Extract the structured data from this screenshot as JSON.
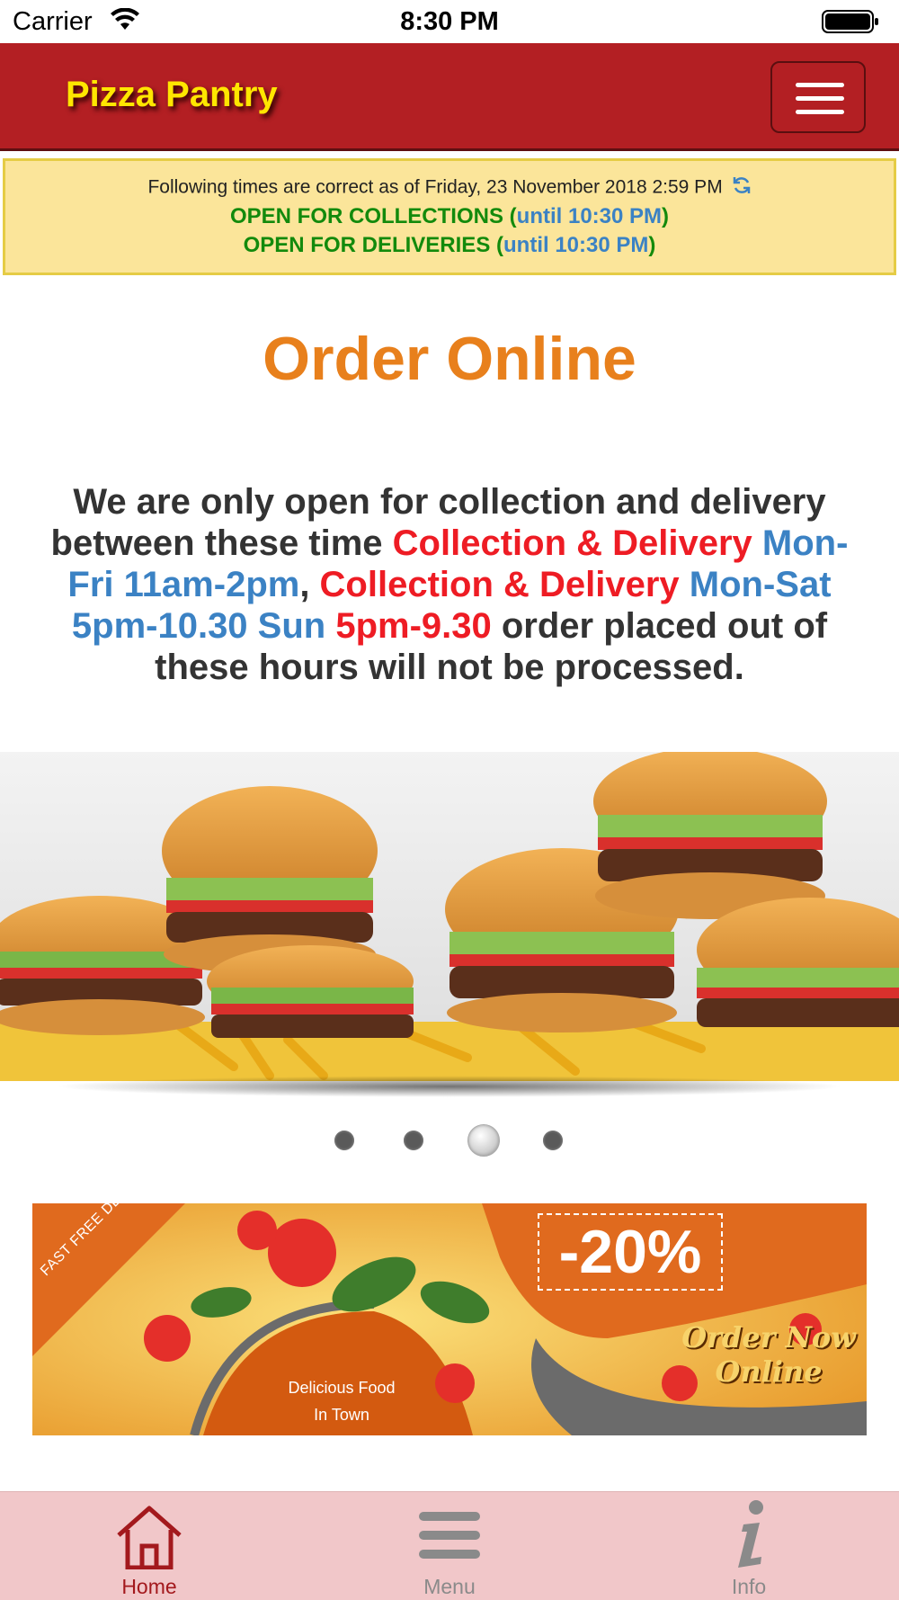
{
  "status_bar": {
    "carrier": "Carrier",
    "time": "8:30 PM"
  },
  "navbar": {
    "brand": "Pizza Pantry"
  },
  "notice": {
    "as_of": "Following times are correct as of Friday, 23 November 2018 2:59 PM",
    "collections_label": "OPEN FOR COLLECTIONS",
    "collections_until": "until 10:30 PM",
    "deliveries_label": "OPEN FOR DELIVERIES",
    "deliveries_until": "until 10:30 PM"
  },
  "main": {
    "heading": "Order Online",
    "hours": {
      "p1": "We are only open for collection and delivery between these time ",
      "p2": "Collection & Delivery",
      "p3": "Mon-Fri 11am-2pm",
      "p4": ", ",
      "p5": "Collection & Delivery",
      "p6": "Mon-Sat 5pm-10.30 Sun ",
      "p7": "5pm-9.30",
      "p8": " order placed out of these hours will not be processed."
    }
  },
  "slider": {
    "active_index": 2,
    "count": 4
  },
  "promo": {
    "fast_delivery": "FAST FREE DELIVERY",
    "discount": "-20%",
    "order_now_line1": "Order Now",
    "order_now_line2": "Online",
    "delicious_line1": "Delicious Food",
    "delicious_line2": "In Town"
  },
  "tabbar": {
    "home": "Home",
    "menu": "Menu",
    "info": "Info"
  },
  "colors": {
    "navbar": "#b31f23",
    "brand": "#ffe600",
    "heading": "#e8801c",
    "open_green": "#138a0c",
    "highlight_blue": "#3b82c4",
    "highlight_red": "#ee1c24",
    "tabbar": "#f1c7c9"
  }
}
